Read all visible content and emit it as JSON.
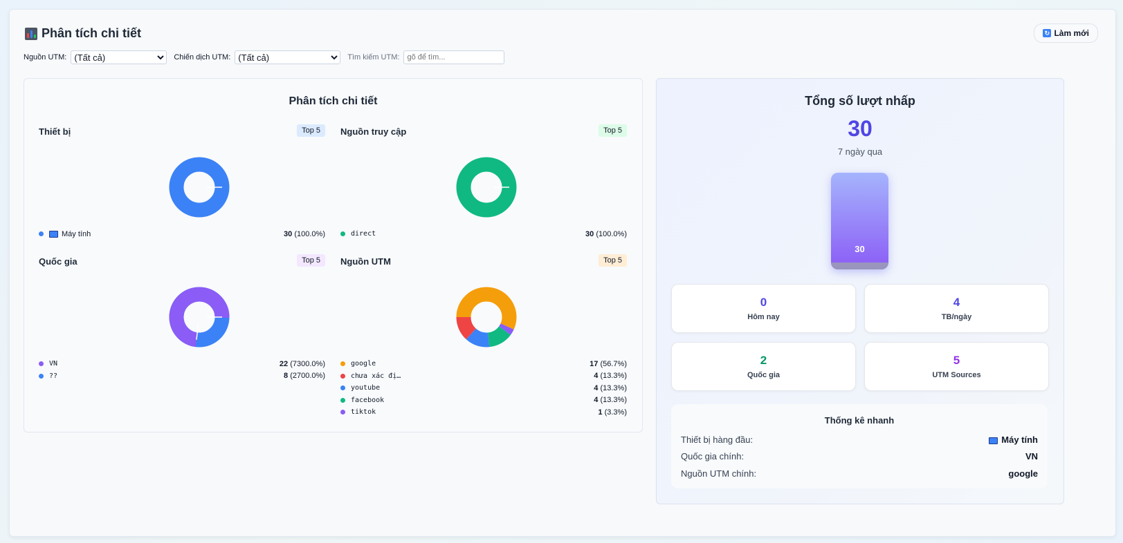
{
  "header": {
    "title": "Phân tích chi tiết",
    "refresh_label": "Làm mới"
  },
  "filters": {
    "utm_source_label": "Nguồn UTM:",
    "utm_source_value": "(Tất cả)",
    "utm_campaign_label": "Chiến dịch UTM:",
    "utm_campaign_value": "(Tất cả)",
    "utm_search_label": "Tìm kiếm UTM:",
    "utm_search_placeholder": "gõ để tìm..."
  },
  "detail": {
    "title": "Phân tích chi tiết",
    "devices": {
      "title": "Thiết bị",
      "badge": "Top 5",
      "items": [
        {
          "name": "Máy tính",
          "count": "30",
          "pct": "(100.0%)",
          "color": "#3b82f6"
        }
      ]
    },
    "traffic": {
      "title": "Nguồn truy cập",
      "badge": "Top 5",
      "items": [
        {
          "name": "direct",
          "count": "30",
          "pct": "(100.0%)",
          "color": "#10b981"
        }
      ]
    },
    "countries": {
      "title": "Quốc gia",
      "badge": "Top 5",
      "items": [
        {
          "name": "VN",
          "count": "22",
          "pct": "(7300.0%)",
          "color": "#8b5cf6"
        },
        {
          "name": "??",
          "count": "8",
          "pct": "(2700.0%)",
          "color": "#3b82f6"
        }
      ]
    },
    "utm": {
      "title": "Nguồn UTM",
      "badge": "Top 5",
      "items": [
        {
          "name": "google",
          "count": "17",
          "pct": "(56.7%)",
          "color": "#f59e0b"
        },
        {
          "name": "chưa xác đị…",
          "count": "4",
          "pct": "(13.3%)",
          "color": "#ef4444"
        },
        {
          "name": "youtube",
          "count": "4",
          "pct": "(13.3%)",
          "color": "#3b82f6"
        },
        {
          "name": "facebook",
          "count": "4",
          "pct": "(13.3%)",
          "color": "#10b981"
        },
        {
          "name": "tiktok",
          "count": "1",
          "pct": "(3.3%)",
          "color": "#8b5cf6"
        }
      ]
    }
  },
  "summary": {
    "title": "Tổng số lượt nhấp",
    "total": "30",
    "period": "7 ngày qua",
    "bar_label": "30",
    "stats": [
      {
        "value": "0",
        "label": "Hôm nay",
        "color": "#4f46e5"
      },
      {
        "value": "4",
        "label": "TB/ngày",
        "color": "#4f46e5"
      },
      {
        "value": "2",
        "label": "Quốc gia",
        "color": "#059669"
      },
      {
        "value": "5",
        "label": "UTM Sources",
        "color": "#9333ea"
      }
    ],
    "quick": {
      "title": "Thống kê nhanh",
      "rows": [
        {
          "label": "Thiết bị hàng đầu:",
          "value": "Máy tính"
        },
        {
          "label": "Quốc gia chính:",
          "value": "VN"
        },
        {
          "label": "Nguồn UTM chính:",
          "value": "google"
        }
      ]
    }
  }
}
